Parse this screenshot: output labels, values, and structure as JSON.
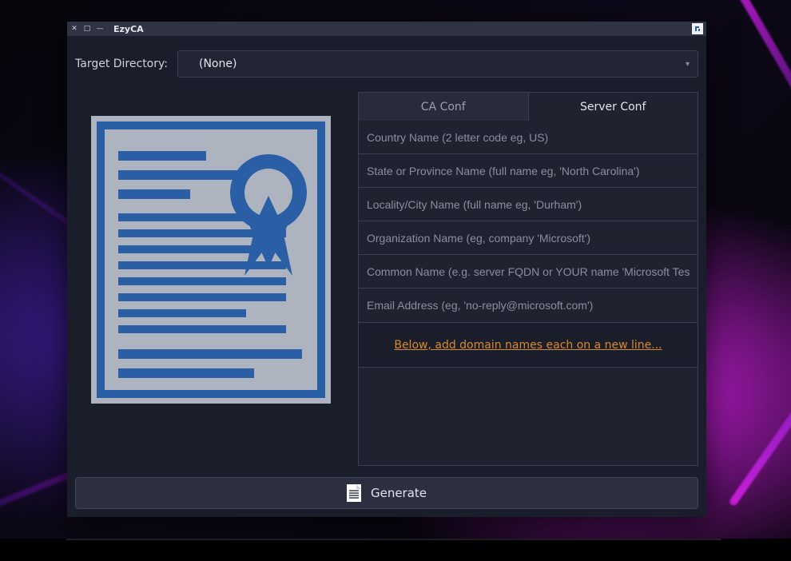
{
  "window": {
    "title": "EzyCA"
  },
  "target": {
    "label": "Target Directory:",
    "value": "(None)"
  },
  "tabs": {
    "ca": "CA Conf",
    "server": "Server Conf",
    "active": "server"
  },
  "fields": {
    "country_ph": "Country Name (2 letter code eg, US)",
    "state_ph": "State or Province Name (full name eg, 'North Carolina')",
    "locality_ph": "Locality/City Name (full name eg, 'Durham')",
    "org_ph": "Organization Name (eg, company 'Microsoft')",
    "cn_ph": "Common Name (e.g. server FQDN or YOUR name 'Microsoft Test...",
    "email_ph": "Email Address (eg, 'no-reply@microsoft.com')",
    "country": "",
    "state": "",
    "locality": "",
    "org": "",
    "cn": "",
    "email": ""
  },
  "domains": {
    "hint": "Below, add domain names each on a new line...",
    "value": ""
  },
  "actions": {
    "generate": "Generate"
  },
  "icons": {
    "close": "✕",
    "maximize": "□",
    "minimize": "—",
    "chevron_down": "▾"
  }
}
